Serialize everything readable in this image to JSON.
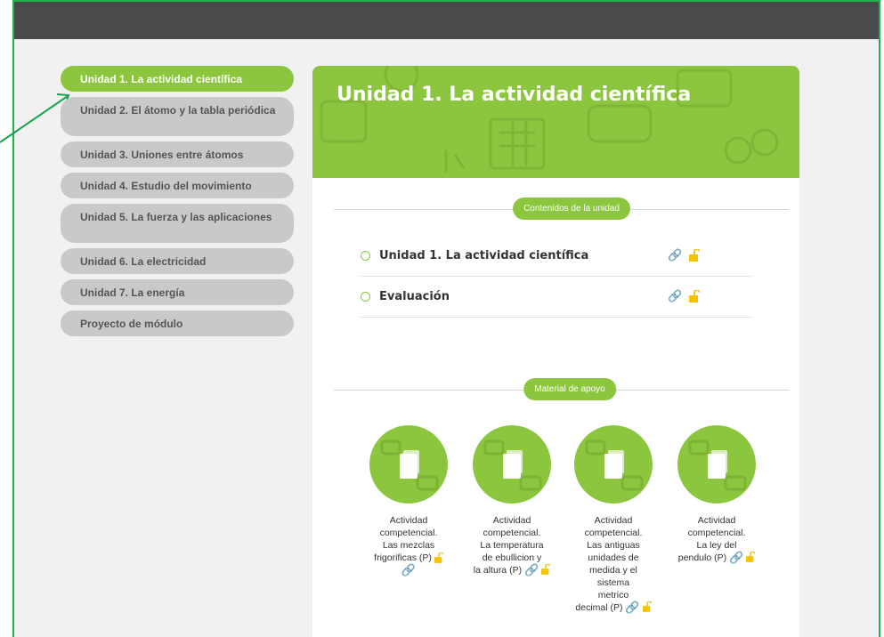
{
  "sidebar": {
    "items": [
      {
        "label": "Unidad 1. La actividad científica",
        "active": true
      },
      {
        "label": "Unidad 2. El átomo y la tabla periódica",
        "active": false
      },
      {
        "label": "Unidad 3. Uniones entre átomos",
        "active": false
      },
      {
        "label": "Unidad 4. Estudio del movimiento",
        "active": false
      },
      {
        "label": "Unidad 5. La fuerza y las aplicaciones",
        "active": false
      },
      {
        "label": "Unidad 6. La electricidad",
        "active": false
      },
      {
        "label": "Unidad 7. La energía",
        "active": false
      },
      {
        "label": "Proyecto de módulo",
        "active": false
      }
    ]
  },
  "banner": {
    "title": "Unidad 1. La actividad científica"
  },
  "contents": {
    "header": "Contenidos de la unidad",
    "rows": [
      {
        "title": "Unidad 1. La actividad científica"
      },
      {
        "title": "Evaluación"
      }
    ]
  },
  "materials": {
    "header": "Material de apoyo",
    "items": [
      {
        "lines": [
          "Actividad",
          "competencial.",
          "Las mezclas",
          "frigorificas (P)"
        ]
      },
      {
        "lines": [
          "Actividad",
          "competencial.",
          "La temperatura",
          "de ebullicion y",
          "la altura (P)"
        ]
      },
      {
        "lines": [
          "Actividad",
          "competencial.",
          "Las antiguas",
          "unidades de",
          "medida y el",
          "sistema",
          "metrico",
          "decimal (P)"
        ]
      },
      {
        "lines": [
          "Actividad",
          "competencial.",
          "La ley del",
          "pendulo (P)"
        ]
      }
    ]
  },
  "colors": {
    "accent": "#8cc63f",
    "topbar": "#4a4a4a",
    "lock": "#f5c400",
    "frame_border": "#22b14c"
  },
  "icons": {
    "link": "link-icon",
    "lock": "unlocked-padlock-icon",
    "bullet": "circle-outline-icon",
    "document": "document-stack-icon"
  }
}
